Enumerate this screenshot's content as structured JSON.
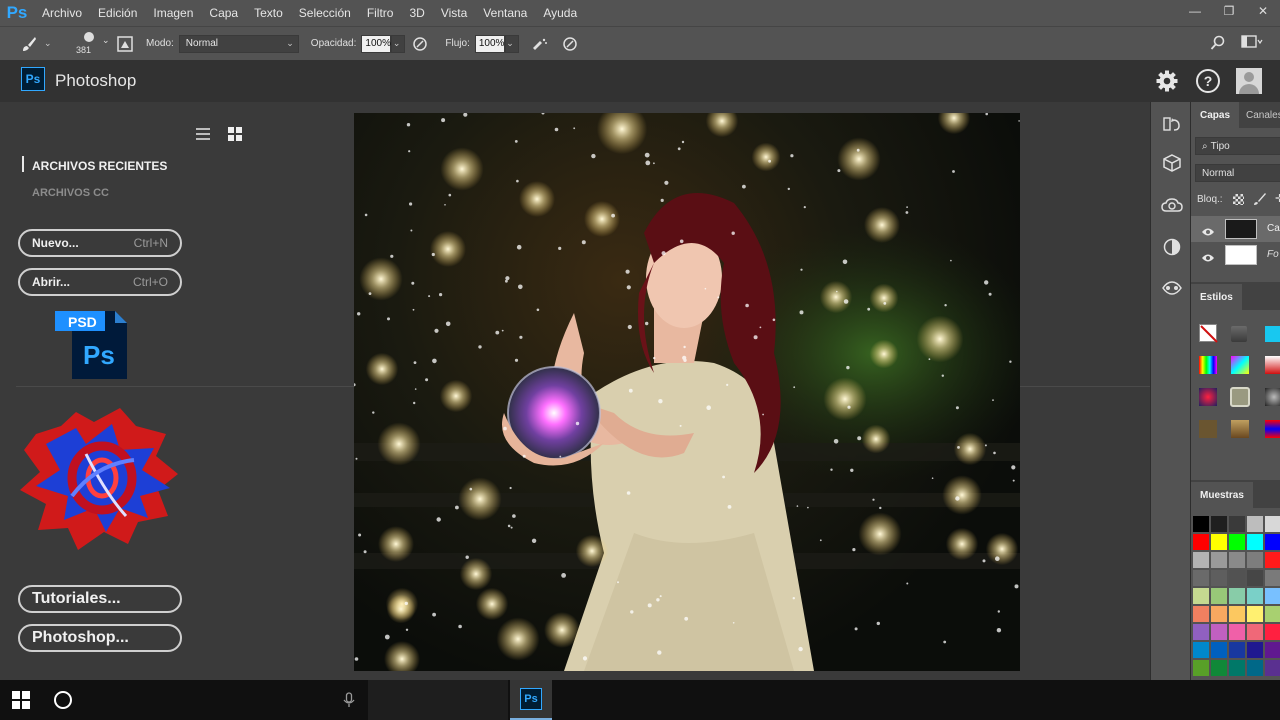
{
  "menubar": {
    "logo": "Ps",
    "items": [
      "Archivo",
      "Edición",
      "Imagen",
      "Capa",
      "Texto",
      "Selección",
      "Filtro",
      "3D",
      "Vista",
      "Ventana",
      "Ayuda"
    ],
    "window_controls": [
      "—",
      "❐",
      "✕"
    ]
  },
  "options": {
    "brush_size": "381",
    "mode_label": "Modo:",
    "mode_value": "Normal",
    "opacity_label": "Opacidad:",
    "opacity_value": "100%",
    "flow_label": "Flujo:",
    "flow_value": "100%"
  },
  "header": {
    "logo": "Ps",
    "app_name": "Photoshop"
  },
  "start": {
    "recent_files": "ARCHIVOS RECIENTES",
    "cc_files": "ARCHIVOS CC",
    "new_label": "Nuevo...",
    "new_shortcut": "Ctrl+N",
    "open_label": "Abrir...",
    "open_shortcut": "Ctrl+O",
    "psd_tag": "PSD",
    "psd_logo": "Ps",
    "tutorials_label": "Tutoriales...",
    "photoshop_label": "Photoshop..."
  },
  "layers_panel": {
    "tabs": [
      "Capas",
      "Canales"
    ],
    "search_label": "Tipo",
    "blend_mode": "Normal",
    "lock_label": "Bloq.:",
    "layer_top": "Cap",
    "layer_bottom": "Fo"
  },
  "styles_panel": {
    "title": "Estilos"
  },
  "swatches_panel": {
    "title": "Muestras",
    "colors": [
      [
        "#000000",
        "#1f1f1f",
        "#3a3a3a",
        "#bdbdbd",
        "#d8d8d8"
      ],
      [
        "#ff0000",
        "#ffff00",
        "#00ff00",
        "#00ffff",
        "#0000ff"
      ],
      [
        "#b3b3b3",
        "#9a9a9a",
        "#8a8a8a",
        "#7d7d7d",
        "#ff1a1a"
      ],
      [
        "#6a6a6a",
        "#5e5e5e",
        "#525252",
        "#464646",
        "#7a7a7a"
      ],
      [
        "#c5d990",
        "#98c878",
        "#88cca8",
        "#7ad0c8",
        "#78c0ff"
      ],
      [
        "#f08060",
        "#f8a860",
        "#fcc860",
        "#fff070",
        "#a8d070"
      ],
      [
        "#9060c0",
        "#c060c0",
        "#f060a8",
        "#f06878",
        "#ff2040"
      ],
      [
        "#0088cc",
        "#0060c0",
        "#1838a0",
        "#201890",
        "#601890"
      ],
      [
        "#58a028",
        "#108838",
        "#007868",
        "#006888",
        "#5a3090"
      ]
    ]
  },
  "colors": {
    "accent": "#31a8ff",
    "chrome": "#535353",
    "workspace": "#3a3a3a"
  }
}
